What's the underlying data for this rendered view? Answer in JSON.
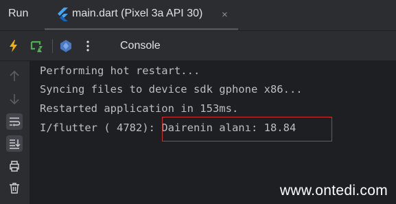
{
  "toolwindow": {
    "title": "Run"
  },
  "tab": {
    "label": "main.dart (Pixel 3a API 30)",
    "close": "×"
  },
  "toolbar": {
    "console_label": "Console"
  },
  "console": {
    "lines": [
      "Performing hot restart...",
      "Syncing files to device sdk gphone x86...",
      "Restarted application in 153ms.",
      "I/flutter ( 4782): Dairenin alanı: 18.84"
    ]
  },
  "watermark": "www.ontedi.com",
  "colors": {
    "accent_lightning": "#f4b400",
    "accent_restart": "#4caf50",
    "highlight_border": "#d32f2f"
  }
}
